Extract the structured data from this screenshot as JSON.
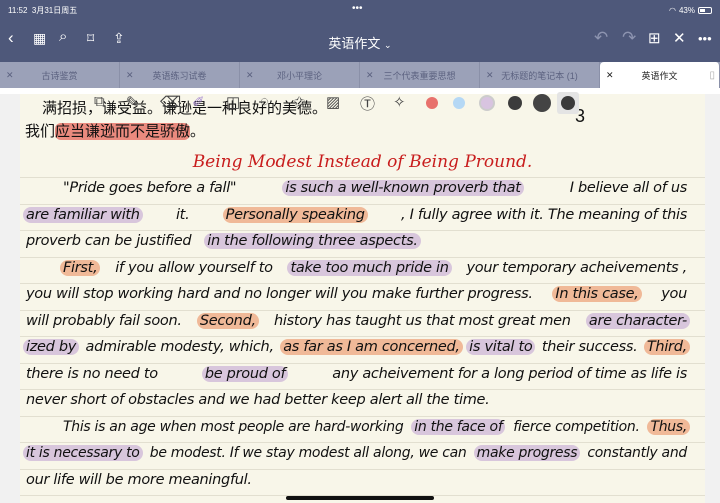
{
  "status": {
    "time": "11:52",
    "date": "3月31日周五",
    "battery": "43%"
  },
  "toolbar": {
    "title": "英语作文",
    "title_chevron": "⌄"
  },
  "tabs": [
    {
      "label": "古诗鉴赏"
    },
    {
      "label": "英语练习试卷"
    },
    {
      "label": "邓小平理论"
    },
    {
      "label": "三个代表重要思想"
    },
    {
      "label": "无标题的笔记本 (1)"
    },
    {
      "label": "英语作文",
      "active": true
    }
  ],
  "colors": {
    "red": "#e8716c",
    "light_blue": "#b5d8f5",
    "lavender": "#d8c4e0",
    "dark1": "#3c3c3c",
    "dark2": "#444444",
    "dark3": "#3a3a3a"
  },
  "page": {
    "cn_line1": "满招损，谦受益。谦逊是一种良好的美德。",
    "cn_line2_prefix": "我们",
    "cn_line2_highlight": "应当谦逊而不是骄傲",
    "cn_line2_suffix": "。",
    "page_number": "3",
    "essay_title": "Being Modest Instead of Being Pround.",
    "lines": [
      [
        {
          "t": "\"Pride goes before a fall\""
        },
        {
          "t": "is such a well-known proverb that",
          "h": "purple"
        },
        {
          "t": "I believe all of us"
        }
      ],
      [
        {
          "t": "are familiar with",
          "h": "purple"
        },
        {
          "t": "it."
        },
        {
          "t": "Personally speaking",
          "h": "orange"
        },
        {
          "t": ", I fully agree with it. The meaning of this"
        }
      ],
      [
        {
          "t": "proverb can be justified"
        },
        {
          "t": "in the following three aspects.",
          "h": "purple"
        }
      ],
      [
        {
          "t": "First,",
          "h": "orange"
        },
        {
          "t": "if you allow yourself to"
        },
        {
          "t": "take too much pride in",
          "h": "purple"
        },
        {
          "t": "your temporary acheivements ,"
        }
      ],
      [
        {
          "t": "you will stop working hard and no longer will you make further progress."
        },
        {
          "t": "In this case,",
          "h": "orange"
        },
        {
          "t": "you"
        }
      ],
      [
        {
          "t": "will probably fail soon."
        },
        {
          "t": "Second,",
          "h": "orange"
        },
        {
          "t": "history has taught us that most great men"
        },
        {
          "t": "are character-",
          "h": "purple"
        }
      ],
      [
        {
          "t": "ized by",
          "h": "purple"
        },
        {
          "t": "admirable modesty, which,"
        },
        {
          "t": "as far as I am concerned,",
          "h": "orange"
        },
        {
          "t": "is vital to",
          "h": "purple"
        },
        {
          "t": "their success."
        },
        {
          "t": "Third,",
          "h": "orange"
        }
      ],
      [
        {
          "t": "there is no need to"
        },
        {
          "t": "be proud of",
          "h": "purple"
        },
        {
          "t": "any acheivement for a long period of time as life is"
        }
      ],
      [
        {
          "t": "never short of obstacles and we had better keep alert all the time."
        }
      ],
      [
        {
          "t": "This is an age when most people are hard-working"
        },
        {
          "t": "in the face of",
          "h": "purple"
        },
        {
          "t": "fierce competition."
        },
        {
          "t": "Thus,",
          "h": "orange"
        }
      ],
      [
        {
          "t": "it is necessary to",
          "h": "purple"
        },
        {
          "t": "be modest. If we stay modest all along, we can"
        },
        {
          "t": "make progress",
          "h": "purple"
        },
        {
          "t": "constantly and"
        }
      ],
      [
        {
          "t": "our life will be more meaningful."
        }
      ]
    ]
  }
}
